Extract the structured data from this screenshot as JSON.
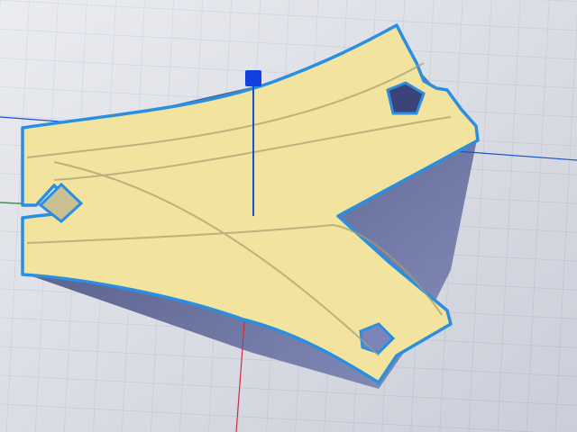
{
  "scene": {
    "colors": {
      "background": "#e4e6ec",
      "grid": "#c6cad6",
      "model_fill": "#f2e39e",
      "model_outline": "#2a8fe0",
      "shadow": "#3a4478",
      "x_axis": "#d03040",
      "y_axis": "#3a9a50",
      "z_axis": "#1a50d0",
      "handle": "#1040e0"
    }
  }
}
